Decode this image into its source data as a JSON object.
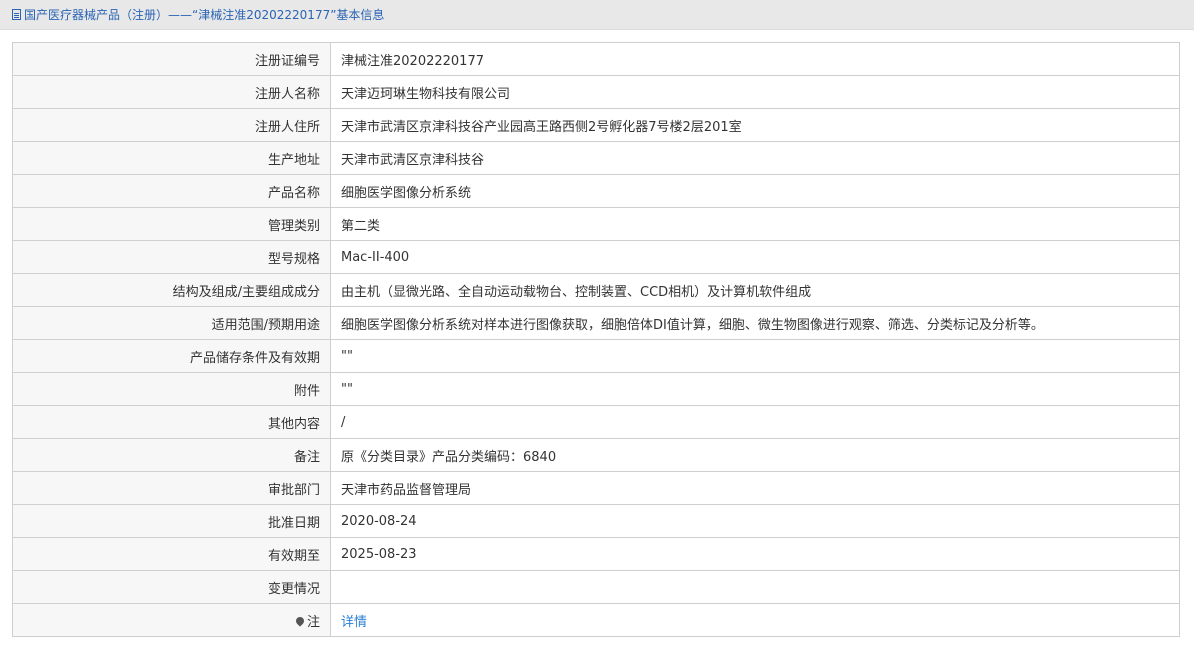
{
  "breadcrumb": {
    "section": "国产医疗器械产品（注册）",
    "separator": " —— ",
    "title": "“津械注准20202220177”基本信息"
  },
  "rows": [
    {
      "label": "注册证编号",
      "value": "津械注准20202220177"
    },
    {
      "label": "注册人名称",
      "value": "天津迈珂琳生物科技有限公司"
    },
    {
      "label": "注册人住所",
      "value": "天津市武清区京津科技谷产业园高王路西侧2号孵化器7号楼2层201室"
    },
    {
      "label": "生产地址",
      "value": "天津市武清区京津科技谷"
    },
    {
      "label": "产品名称",
      "value": "细胞医学图像分析系统"
    },
    {
      "label": "管理类别",
      "value": "第二类"
    },
    {
      "label": "型号规格",
      "value": "Mac-II-400"
    },
    {
      "label": "结构及组成/主要组成成分",
      "value": "由主机（显微光路、全自动运动载物台、控制装置、CCD相机）及计算机软件组成"
    },
    {
      "label": "适用范围/预期用途",
      "value": "细胞医学图像分析系统对样本进行图像获取，细胞倍体DI值计算，细胞、微生物图像进行观察、筛选、分类标记及分析等。"
    },
    {
      "label": "产品储存条件及有效期",
      "value": "\"\""
    },
    {
      "label": "附件",
      "value": "\"\""
    },
    {
      "label": "其他内容",
      "value": "/"
    },
    {
      "label": "备注",
      "value": "原《分类目录》产品分类编码：6840"
    },
    {
      "label": "审批部门",
      "value": "天津市药品监督管理局"
    },
    {
      "label": "批准日期",
      "value": "2020-08-24"
    },
    {
      "label": "有效期至",
      "value": "2025-08-23"
    },
    {
      "label": "变更情况",
      "value": ""
    }
  ],
  "note": {
    "label": "注",
    "link": "详情"
  }
}
